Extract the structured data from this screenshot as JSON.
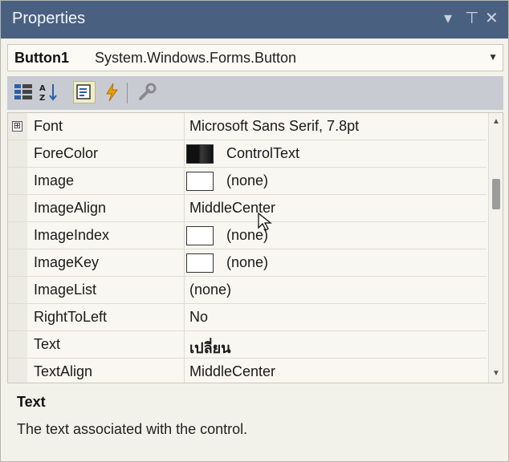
{
  "window": {
    "title": "Properties",
    "pin_glyph": "⊤",
    "close_glyph": "✕",
    "menu_glyph": "▾"
  },
  "object_selector": {
    "name": "Button1",
    "type": "System.Windows.Forms.Button",
    "arrow": "▼"
  },
  "toolbar": {
    "buttons": [
      "categorized-icon",
      "alphabetical-icon",
      "properties-icon",
      "events-icon",
      "property-pages-icon"
    ]
  },
  "grid": {
    "rows": [
      {
        "name": "Font",
        "value": "Microsoft Sans Serif, 7.8pt",
        "expandable": true,
        "expander": "⊞"
      },
      {
        "name": "ForeColor",
        "value": "ControlText",
        "swatch": "#111111"
      },
      {
        "name": "Image",
        "value": "(none)",
        "swatch": "#ffffff"
      },
      {
        "name": "ImageAlign",
        "value": "MiddleCenter"
      },
      {
        "name": "ImageIndex",
        "value": "(none)",
        "swatch": "#ffffff"
      },
      {
        "name": "ImageKey",
        "value": "(none)",
        "swatch": "#ffffff"
      },
      {
        "name": "ImageList",
        "value": "(none)"
      },
      {
        "name": "RightToLeft",
        "value": "No"
      },
      {
        "name": "Text",
        "value": "เปลี่ยน",
        "bold": true
      },
      {
        "name": "TextAlign",
        "value": "MiddleCenter"
      }
    ],
    "scroll_up": "▲",
    "scroll_down": "▼"
  },
  "description": {
    "title": "Text",
    "text": "The text associated with the control."
  },
  "colors": {
    "titlebar": "#4a6080",
    "toolbar": "#c9cbd3",
    "events_icon": "#e8a300"
  }
}
